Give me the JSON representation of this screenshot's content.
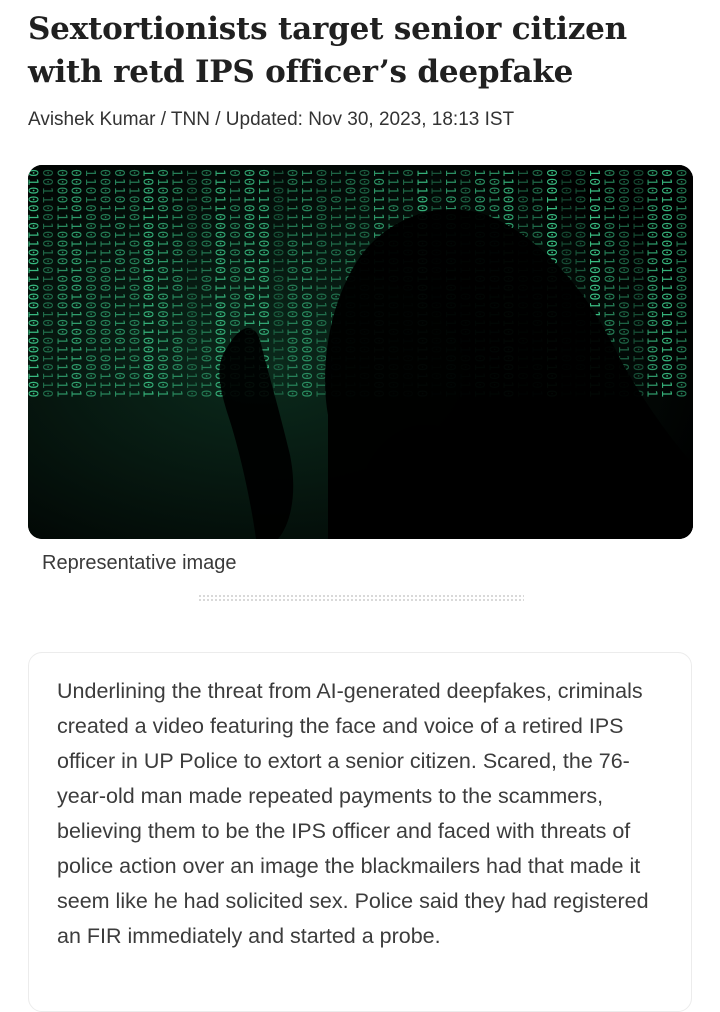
{
  "article": {
    "headline": "Sextortionists target senior citizen with retd IPS officer’s deepfake",
    "byline": "Avishek Kumar / TNN / Updated: Nov 30, 2023, 18:13 IST",
    "image_caption": "Representative image",
    "summary": "Underlining the threat from AI-generated deepfakes, criminals created a video featuring the face and voice of a retired IPS officer in UP Police to extort a senior citizen. Scared, the 76-year-old man made repeated payments to the scammers, believing them to be the IPS officer and faced with threats of police action over an image the blackmailers had that made it seem like he had solicited sex. Police said they had registered an FIR immediately and started a probe."
  },
  "colors": {
    "matrix_green": "#3dc88a",
    "background": "#ffffff"
  }
}
